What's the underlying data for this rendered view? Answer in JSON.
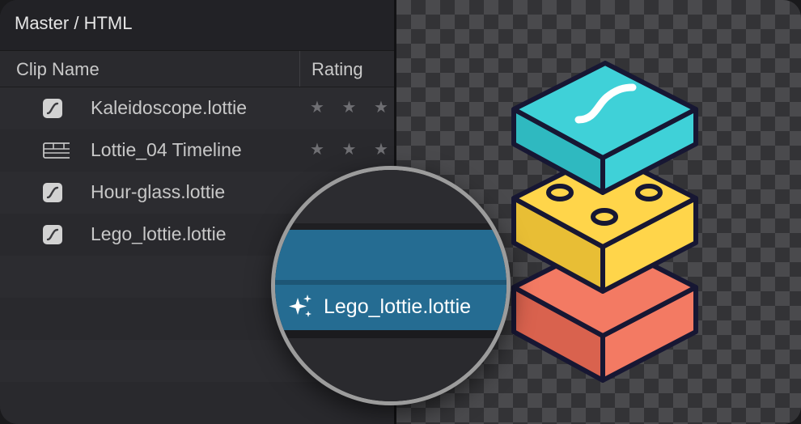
{
  "header": {
    "title": "Master / HTML"
  },
  "columns": {
    "clip_name": "Clip Name",
    "rating": "Rating"
  },
  "clips": [
    {
      "name": "Kaleidoscope.lottie",
      "icon": "lottie-clip-icon",
      "stars": "★ ★ ★"
    },
    {
      "name": "Lottie_04 Timeline",
      "icon": "timeline-icon",
      "stars": "★ ★ ★"
    },
    {
      "name": "Hour-glass.lottie",
      "icon": "lottie-clip-icon",
      "stars": ""
    },
    {
      "name": "Lego_lottie.lottie",
      "icon": "lottie-clip-icon",
      "stars": ""
    }
  ],
  "magnifier": {
    "selected_label": "Lego_lottie.lottie",
    "icon": "sparkle-icon"
  },
  "colors": {
    "selection": "#256c92",
    "lego_top": "#3fd1d8",
    "lego_middle": "#ffd54a",
    "lego_bottom": "#f37a63",
    "outline": "#171733"
  }
}
